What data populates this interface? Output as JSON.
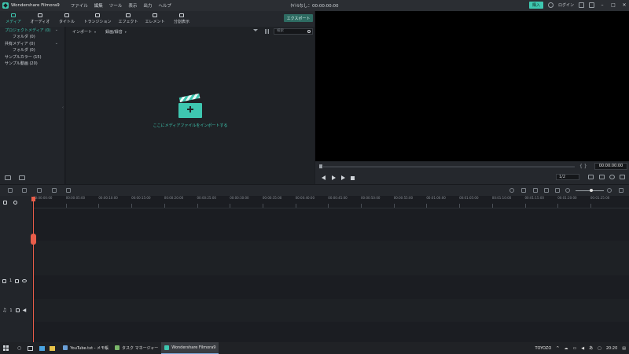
{
  "app": {
    "name": "Wondershare Filmora9",
    "project_title": "ﾀｲﾄﾙなし：00:00:00:00",
    "menu": [
      "ファイル",
      "編集",
      "ツール",
      "表示",
      "出力",
      "ヘルプ"
    ],
    "buy_label": "購入",
    "login_label": "ログイン"
  },
  "toolbar": {
    "tabs": [
      {
        "label": "メディア",
        "icon": "folder-icon",
        "active": true
      },
      {
        "label": "オーディオ",
        "icon": "music-note-icon"
      },
      {
        "label": "タイトル",
        "icon": "text-icon"
      },
      {
        "label": "トランジション",
        "icon": "transition-icon"
      },
      {
        "label": "エフェクト",
        "icon": "effect-icon"
      },
      {
        "label": "エレメント",
        "icon": "element-icon"
      },
      {
        "label": "分割表示",
        "icon": "split-screen-icon"
      }
    ],
    "export_label": "エクスポート"
  },
  "library": {
    "items": [
      {
        "label": "プロジェクトメディア (0)",
        "active": true,
        "expand": true
      },
      {
        "label": "フォルダ (0)",
        "indent": true
      },
      {
        "label": "共有メディア (0)",
        "expand": true
      },
      {
        "label": "フォルダ (0)",
        "indent": true
      },
      {
        "label": "サンプルカラー (15)"
      },
      {
        "label": "サンプル動画 (20)"
      }
    ]
  },
  "media": {
    "import_dropdown": "インポート",
    "record_dropdown": "録画/録音",
    "search_placeholder": "検索",
    "import_hint": "ここにメディアファイルをインポートする"
  },
  "preview": {
    "timecode": "00:00:00:00",
    "ratio": "1/2",
    "brackets": "{ }"
  },
  "timeline": {
    "ticks": [
      "00:00:00:00",
      "00:00:05:00",
      "00:00:10:00",
      "00:00:15:00",
      "00:00:20:00",
      "00:00:25:00",
      "00:00:30:00",
      "00:00:35:00",
      "00:00:40:00",
      "00:00:45:00",
      "00:00:50:00",
      "00:00:55:00",
      "00:01:00:00",
      "00:01:05:00",
      "00:01:10:00",
      "00:01:15:00",
      "00:01:20:00",
      "00:01:25:00"
    ],
    "video_track_num": "1",
    "audio_track_num": "1"
  },
  "taskbar": {
    "apps": [
      {
        "label": "YouTube.txt - メモ帳",
        "color": "#6aa0d8"
      },
      {
        "label": "タスク マネージャー",
        "color": "#7bb86a"
      },
      {
        "label": "Wondershare Filmora9",
        "color": "#3ec7b0",
        "active": true
      }
    ],
    "user": "TOYOZO",
    "ime": "あ",
    "clock": "20:20"
  },
  "colors": {
    "accent": "#3ec7b0",
    "playhead": "#e85d4a"
  }
}
